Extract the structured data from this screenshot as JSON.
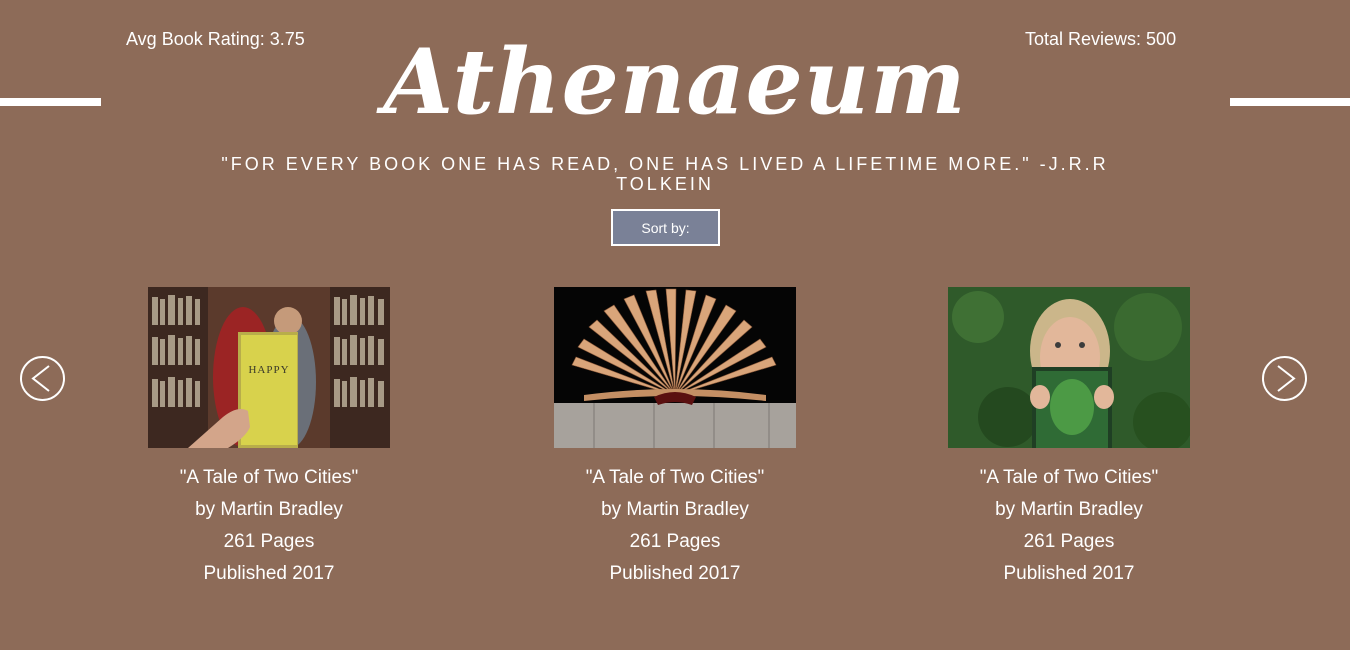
{
  "header": {
    "avg_rating": "Avg Book Rating: 3.75",
    "total_reviews": "Total Reviews: 500",
    "title": "Athenaeum",
    "quote": "\"FOR EVERY BOOK ONE HAS READ, ONE HAS LIVED A LIFETIME MORE.\" -J.R.R TOLKEIN"
  },
  "controls": {
    "sort_label": "Sort by:",
    "prev_icon": "chevron-left-circle-icon",
    "next_icon": "chevron-right-circle-icon"
  },
  "books": [
    {
      "title": "\"A Tale of Two Cities\"",
      "author": "by Martin Bradley",
      "pages": "261 Pages",
      "published": "Published 2017",
      "cover_text": "HAPPY",
      "cover_icon": "hand-holding-book-photo"
    },
    {
      "title": "\"A Tale of Two Cities\"",
      "author": "by Martin Bradley",
      "pages": "261 Pages",
      "published": "Published 2017",
      "cover_icon": "open-book-photo"
    },
    {
      "title": "\"A Tale of Two Cities\"",
      "author": "by Martin Bradley",
      "pages": "261 Pages",
      "published": "Published 2017",
      "cover_icon": "woman-reading-book-photo"
    }
  ],
  "colors": {
    "background": "#8d6b58",
    "sort_button": "#7a8197",
    "text": "#ffffff"
  }
}
